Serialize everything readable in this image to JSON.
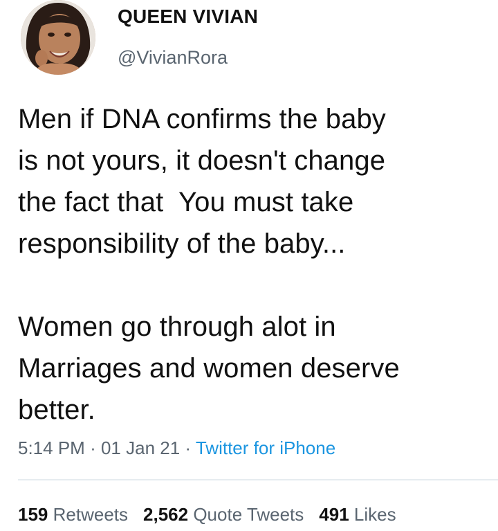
{
  "user": {
    "display_name": "QUEEN VIVIAN",
    "handle": "@VivianRora",
    "avatar_icon": "profile-photo"
  },
  "tweet": {
    "paragraphs": [
      [
        "Men if DNA confirms the baby",
        "is not yours, it doesn't change",
        "the fact that  You must take",
        "responsibility of the baby..."
      ],
      [
        "Women go through alot in",
        "Marriages and women deserve",
        "better."
      ]
    ],
    "time": "5:14 PM",
    "date": "01 Jan 21",
    "source": "Twitter for iPhone",
    "separator": "·"
  },
  "stats": {
    "retweets_count": "159",
    "retweets_label": "Retweets",
    "quote_count": "2,562",
    "quote_label": "Quote Tweets",
    "likes_count": "491",
    "likes_label": "Likes"
  },
  "colors": {
    "link": "#1b95e0",
    "secondary_text": "#5a6570",
    "divider": "#e6ecf0"
  }
}
